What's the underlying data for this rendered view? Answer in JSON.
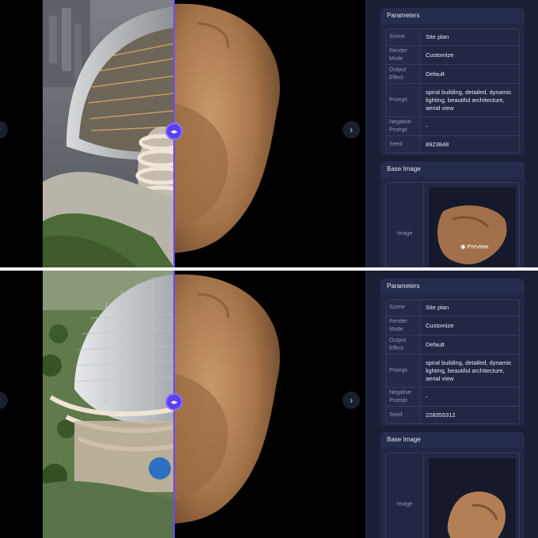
{
  "nav": {
    "prev_icon": "chevron-left-icon",
    "next_icon": "chevron-right-icon",
    "next_glyph": "›",
    "prev_glyph": "‹"
  },
  "compare_handle": {
    "glyph": "◂▸",
    "icon": "compare-handle-icon"
  },
  "panels": [
    {
      "params_title": "Parameters",
      "params": [
        {
          "key": "Scene",
          "value": "Site plan"
        },
        {
          "key": "Render Mode",
          "value": "Customize"
        },
        {
          "key": "Output Effect",
          "value": "Default"
        },
        {
          "key": "Prompt",
          "value": "spiral building, detailed, dynamic lighting, beautiful architecture, aerial view"
        },
        {
          "key": "Negative Prompt",
          "value": "-"
        },
        {
          "key": "Seed",
          "value": "8923848"
        }
      ],
      "base_title": "Base Image",
      "base_key": "Image",
      "preview_label": "Preview"
    },
    {
      "params_title": "Parameters",
      "params": [
        {
          "key": "Scene",
          "value": "Site plan"
        },
        {
          "key": "Render Mode",
          "value": "Customize"
        },
        {
          "key": "Output Effect",
          "value": "Default"
        },
        {
          "key": "Prompt",
          "value": "spiral building, detailed, dynamic lighting, beautiful architecture, aerial view"
        },
        {
          "key": "Negative Prompt",
          "value": "-"
        },
        {
          "key": "Seed",
          "value": "228355312"
        }
      ],
      "base_title": "Base Image",
      "base_key": "Image",
      "preview_label": ""
    }
  ],
  "colors": {
    "accent": "#5b3ff0",
    "sidebar_bg": "#1a1f36",
    "card_bg": "#222844"
  }
}
